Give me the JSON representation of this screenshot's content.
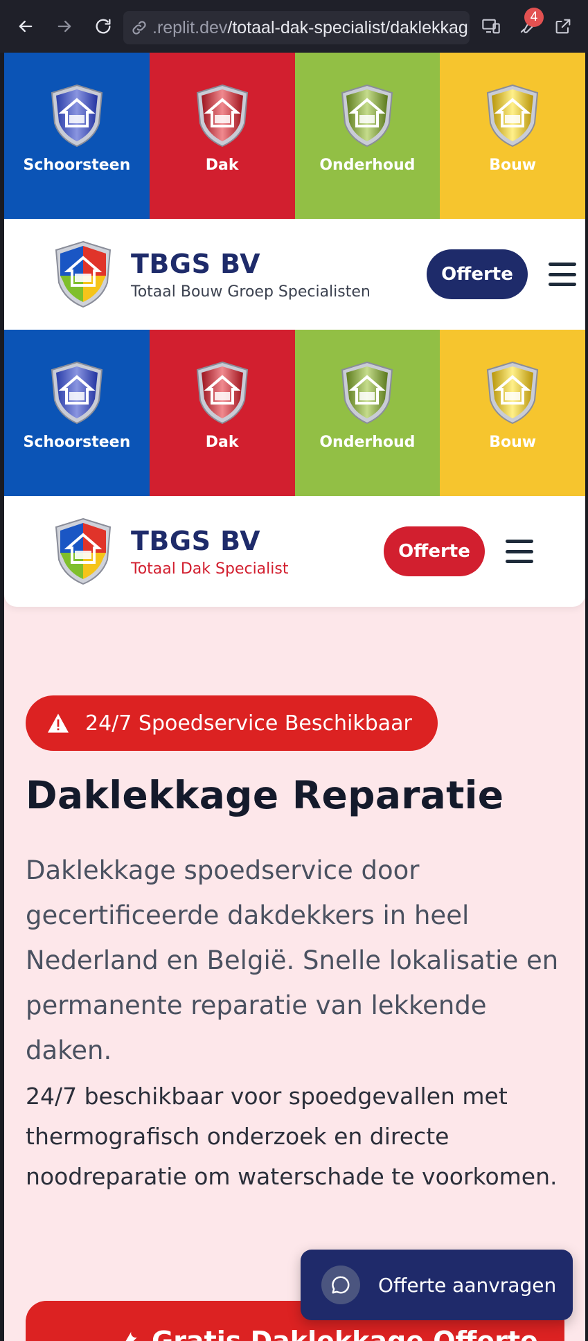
{
  "browser": {
    "url_host_prefix": ".replit.dev",
    "url_path": "/totaal-dak-specialist/daklekkag",
    "badge_count": "4"
  },
  "tiles_row_1": [
    {
      "label": "Schoorsteen",
      "color": "#0b54b6"
    },
    {
      "label": "Dak",
      "color": "#d21f2f"
    },
    {
      "label": "Onderhoud",
      "color": "#92bf45"
    },
    {
      "label": "Bouw",
      "color": "#f6c52e"
    }
  ],
  "header_1": {
    "brand": "TBGS BV",
    "subtitle": "Totaal Bouw Groep Specialisten",
    "subtitle_color": "#3c4250",
    "offerte_label": "Offerte",
    "offerte_color": "#1e2b6a"
  },
  "tiles_row_2": [
    {
      "label": "Schoorsteen",
      "color": "#0b54b6"
    },
    {
      "label": "Dak",
      "color": "#d21f2f"
    },
    {
      "label": "Onderhoud",
      "color": "#92bf45"
    },
    {
      "label": "Bouw",
      "color": "#f6c52e"
    }
  ],
  "header_2": {
    "brand": "TBGS BV",
    "subtitle": "Totaal Dak Specialist",
    "subtitle_color": "#d21f2f",
    "offerte_label": "Offerte",
    "offerte_color": "#d21f2f"
  },
  "hero": {
    "badge": "24/7 Spoedservice Beschikbaar",
    "title": "Daklekkage Reparatie",
    "lead": "Daklekkage spoedservice door gecertificeerde dakdekkers in heel Nederland en België. Snelle lokalisatie en permanente reparatie van lekkende daken.",
    "body": "24/7 beschikbaar voor spoedgevallen met thermografisch onderzoek en directe noodreparatie om waterschade te voorkomen.",
    "cta_partial": "Gratis Daklekkage Offerte"
  },
  "floating": {
    "label": "Offerte aanvragen"
  },
  "icons": [
    "back-icon",
    "forward-icon",
    "reload-icon",
    "link-icon",
    "device-icon",
    "wrench-icon",
    "external-link-icon",
    "warning-icon",
    "chat-icon",
    "wrench-cta-icon",
    "hamburger-icon"
  ]
}
